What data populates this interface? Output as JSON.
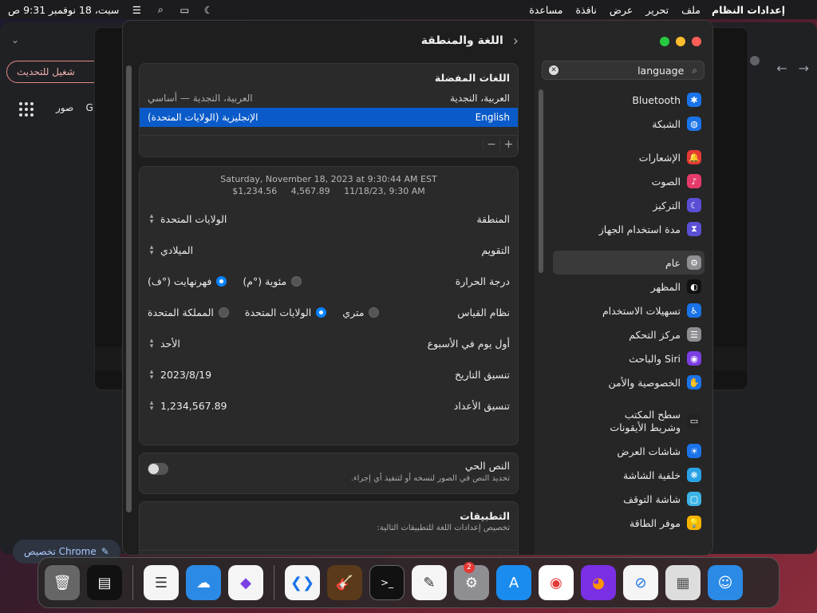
{
  "menubar": {
    "apple": "",
    "app_name": "إعدادات النظام",
    "menus": [
      "ملف",
      "تحرير",
      "عرض",
      "نافذة",
      "مساعدة"
    ],
    "clock": "سبت، 18 نوفمبر 9:31 ص"
  },
  "chrome_bg": {
    "update_pill": "شغيل للتحديث",
    "link_images": "صور",
    "link_g": "G",
    "customize": "تخصيص Chrome"
  },
  "settings": {
    "header_title": "اللغة والمنطقة",
    "preferred_languages": {
      "title": "اللغات المفضلة",
      "rows": [
        {
          "name": "العربية، النجدية",
          "sub": "العربية، النجدية — أساسي"
        },
        {
          "name": "English",
          "sub": "الإنجليزية (الولايات المتحدة)"
        }
      ],
      "plus": "+",
      "minus": "−"
    },
    "preview": {
      "line1": "Saturday, November 18, 2023 at 9:30:44 AM EST",
      "line2": "$1,234.56     4,567.89     11/18/23, 9:30 AM"
    },
    "rows": {
      "region_label": "المنطقة",
      "region_value": "الولايات المتحدة",
      "calendar_label": "التقويم",
      "calendar_value": "الميلادي",
      "temp_label": "درجة الحرارة",
      "temp_c": "مئوية (°م)",
      "temp_f": "فهرنهايت (°ف)",
      "measure_label": "نظام القياس",
      "measure_metric": "متري",
      "measure_us": "الولايات المتحدة",
      "measure_uk": "المملكة المتحدة",
      "week_label": "أول يوم في الأسبوع",
      "week_value": "الأحد",
      "date_label": "تنسيق التاريخ",
      "date_value": "2023/8/19",
      "number_label": "تنسيق الأعداد",
      "number_value": "1,234,567.89"
    },
    "live_text": {
      "title": "النص الحي",
      "desc": "تحديد النص في الصور لنسخه أو لتنفيذ أي إجراء."
    },
    "apps": {
      "title": "التطبيقات",
      "desc": "تخصيص إعدادات اللغة للتطبيقات التالية:"
    }
  },
  "sidebar": {
    "search_value": "language",
    "items": [
      {
        "label": "Bluetooth",
        "icon": "bluetooth-icon",
        "color": "#1a73e8",
        "glyph": "✱"
      },
      {
        "label": "الشبكة",
        "icon": "globe-icon",
        "color": "#1a73e8",
        "glyph": "◍"
      },
      {
        "label": "الإشعارات",
        "icon": "bell-icon",
        "color": "#e53935",
        "glyph": "🔔"
      },
      {
        "label": "الصوت",
        "icon": "speaker-icon",
        "color": "#e53a6a",
        "glyph": "♪"
      },
      {
        "label": "التركيز",
        "icon": "moon-icon",
        "color": "#5b4fd6",
        "glyph": "☾"
      },
      {
        "label": "مدة استخدام الجهاز",
        "icon": "hourglass-icon",
        "color": "#5b4fd6",
        "glyph": "⧗"
      },
      {
        "label": "عام",
        "icon": "gear-icon",
        "color": "#8e8e93",
        "glyph": "⚙"
      },
      {
        "label": "المظهر",
        "icon": "appearance-icon",
        "color": "#111111",
        "glyph": "◐"
      },
      {
        "label": "تسهيلات الاستخدام",
        "icon": "accessibility-icon",
        "color": "#1a73e8",
        "glyph": "♿"
      },
      {
        "label": "مركز التحكم",
        "icon": "control-center-icon",
        "color": "#8e8e93",
        "glyph": "☰"
      },
      {
        "label": "Siri والباحث",
        "icon": "siri-icon",
        "color": "#7b3fe4",
        "glyph": "◉"
      },
      {
        "label": "الخصوصية والأمن",
        "icon": "hand-icon",
        "color": "#1a73e8",
        "glyph": "✋"
      },
      {
        "label": "سطح المكتب وشريط الأيقونات",
        "icon": "dock-icon",
        "color": "#222222",
        "glyph": "▭"
      },
      {
        "label": "شاشات العرض",
        "icon": "display-icon",
        "color": "#1a73e8",
        "glyph": "☀"
      },
      {
        "label": "خلفية الشاشة",
        "icon": "wallpaper-icon",
        "color": "#29a3e6",
        "glyph": "❋"
      },
      {
        "label": "شاشة التوقف",
        "icon": "screensaver-icon",
        "color": "#3cb4e6",
        "glyph": "▢"
      },
      {
        "label": "موفر الطاقة",
        "icon": "bulb-icon",
        "color": "#f4b400",
        "glyph": "💡"
      }
    ]
  },
  "dock": {
    "badge": "2"
  }
}
